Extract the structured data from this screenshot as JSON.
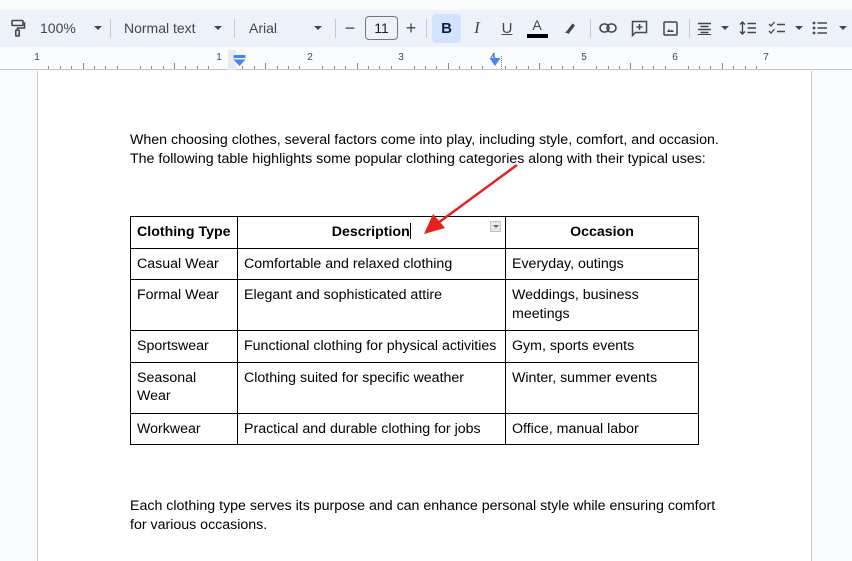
{
  "toolbar": {
    "zoom": "100%",
    "style": "Normal text",
    "font": "Arial",
    "font_size": "11",
    "decrease_label": "−",
    "increase_label": "+",
    "bold_label": "B",
    "italic_label": "I",
    "underline_label": "U",
    "text_color_label": "A",
    "text_color": "#000000",
    "bold_active": true,
    "icons": [
      "paint-format-icon",
      "highlight-pen-icon",
      "link-icon",
      "add-comment-icon",
      "insert-image-icon",
      "align-center-icon",
      "line-spacing-icon",
      "checklist-icon",
      "bulleted-list-icon"
    ]
  },
  "ruler": {
    "numbers": [
      "1",
      "1",
      "2",
      "3",
      "4",
      "5",
      "6",
      "7"
    ]
  },
  "document": {
    "intro_line1": "When choosing clothes, several factors come into play, including style, comfort, and occasion.",
    "intro_line2": "The following table highlights some popular clothing categories along with their typical uses:",
    "table": {
      "headers": [
        "Clothing Type",
        "Description",
        "Occasion"
      ],
      "rows": [
        [
          "Casual Wear",
          "Comfortable and relaxed clothing",
          "Everyday, outings"
        ],
        [
          "Formal Wear",
          "Elegant and sophisticated attire",
          "Weddings, business meetings"
        ],
        [
          "Sportswear",
          "Functional clothing for physical activities",
          "Gym, sports events"
        ],
        [
          "Seasonal Wear",
          "Clothing suited for specific weather",
          "Winter, summer events"
        ],
        [
          "Workwear",
          "Practical and durable clothing for jobs",
          "Office, manual labor"
        ]
      ]
    },
    "closing_line1": "Each clothing type serves its purpose and can enhance personal style while ensuring comfort",
    "closing_line2": "for various occasions."
  },
  "annotation": {
    "arrow_color": "#e8201c"
  }
}
